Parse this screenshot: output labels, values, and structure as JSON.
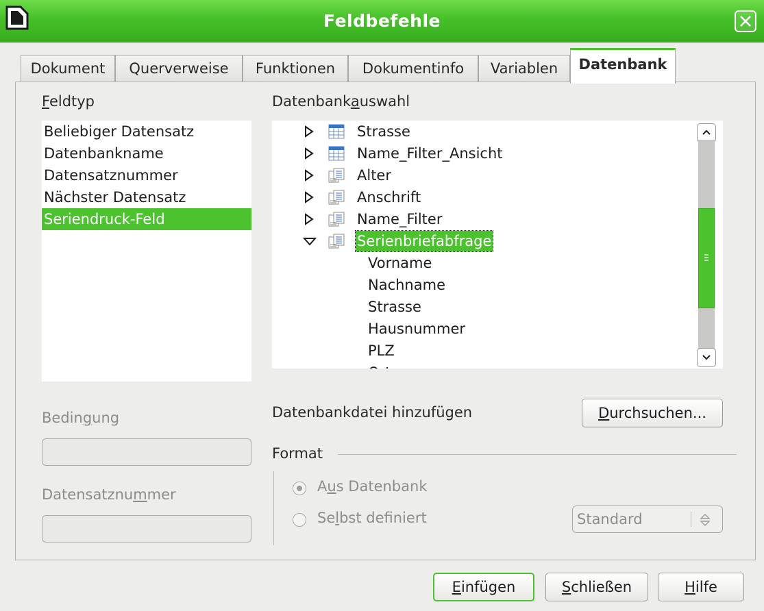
{
  "window": {
    "title": "Feldbefehle",
    "close_icon": "close-icon",
    "accent": "#4cc22e"
  },
  "tabs": [
    {
      "label": "Dokument"
    },
    {
      "label": "Querverweise"
    },
    {
      "label": "Funktionen"
    },
    {
      "label": "Dokumentinfo"
    },
    {
      "label": "Variablen"
    },
    {
      "label": "Datenbank",
      "active": true
    }
  ],
  "feldtyp": {
    "label_pre": "",
    "label_ul": "F",
    "label_post": "eldtyp",
    "items": [
      {
        "label": "Beliebiger Datensatz"
      },
      {
        "label": "Datenbankname"
      },
      {
        "label": "Datensatznummer"
      },
      {
        "label": "Nächster Datensatz"
      },
      {
        "label": "Seriendruck-Feld",
        "selected": true
      }
    ]
  },
  "datenbankauswahl": {
    "label_pre": "Datenbank",
    "label_ul": "a",
    "label_post": "uswahl",
    "tree": [
      {
        "label": "Strasse",
        "icon": "table-icon",
        "expanded": false
      },
      {
        "label": "Name_Filter_Ansicht",
        "icon": "table-icon",
        "expanded": false
      },
      {
        "label": "Alter",
        "icon": "query-icon",
        "expanded": false
      },
      {
        "label": "Anschrift",
        "icon": "query-icon",
        "expanded": false
      },
      {
        "label": "Name_Filter",
        "icon": "query-icon",
        "expanded": false
      },
      {
        "label": "Serienbriefabfrage",
        "icon": "query-icon",
        "expanded": true,
        "selected": true
      },
      {
        "label": "Vorname",
        "child": true
      },
      {
        "label": "Nachname",
        "child": true
      },
      {
        "label": "Strasse",
        "child": true
      },
      {
        "label": "Hausnummer",
        "child": true
      },
      {
        "label": "PLZ",
        "child": true
      },
      {
        "label": "Ort",
        "child": true
      }
    ]
  },
  "bedingung": {
    "label_pre": "Bedin",
    "label_ul": "g",
    "label_post": "ung",
    "value": ""
  },
  "datensatznummer": {
    "label_pre": "Datensatznu",
    "label_ul": "m",
    "label_post": "mer",
    "value": ""
  },
  "add_db_file": {
    "label": "Datenbankdatei hinzufügen"
  },
  "browse_button": {
    "ul": "D",
    "rest": "urchsuchen..."
  },
  "format": {
    "label": "Format",
    "options": [
      {
        "pre": "A",
        "ul": "u",
        "post": "s Datenbank",
        "checked": true
      },
      {
        "pre": "Se",
        "ul": "l",
        "post": "bst definiert",
        "checked": false
      }
    ],
    "combo_value": "Standard"
  },
  "footer": {
    "insert": {
      "ul": "E",
      "rest": "infügen"
    },
    "close": {
      "ul": "S",
      "rest": "chließen"
    },
    "help": {
      "ul": "H",
      "rest": "ilfe"
    }
  }
}
